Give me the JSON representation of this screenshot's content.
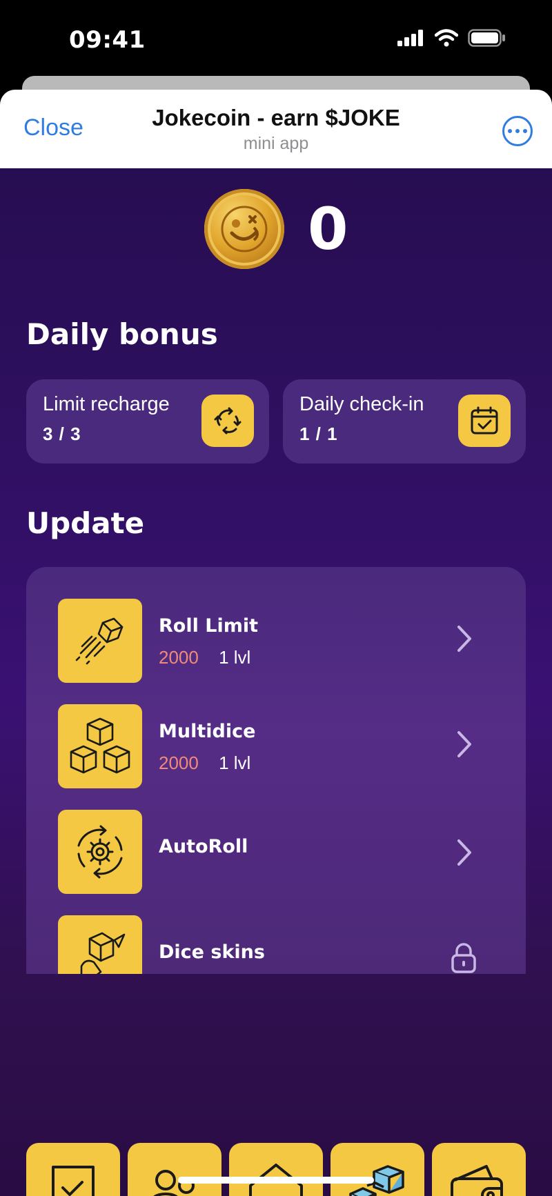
{
  "status_bar": {
    "time": "09:41",
    "icons": [
      "signal-icon",
      "wifi-icon",
      "battery-icon"
    ]
  },
  "header": {
    "close_label": "Close",
    "title": "Jokecoin - earn $JOKE",
    "subtitle": "mini app",
    "more_icon": "more-icon"
  },
  "balance": {
    "value": "0",
    "icon": "coin-icon"
  },
  "daily_bonus": {
    "title": "Daily bonus",
    "cards": [
      {
        "label": "Limit recharge",
        "count": "3 / 3",
        "icon": "recharge-icon"
      },
      {
        "label": "Daily check-in",
        "count": "1 / 1",
        "icon": "calendar-check-icon"
      }
    ]
  },
  "update": {
    "title": "Update",
    "items": [
      {
        "name": "Roll Limit",
        "price": "2000",
        "level": "1 lvl",
        "icon": "flying-cube-icon",
        "action": "chevron"
      },
      {
        "name": "Multidice",
        "price": "2000",
        "level": "1 lvl",
        "icon": "cubes-icon",
        "action": "chevron"
      },
      {
        "name": "AutoRoll",
        "icon": "gear-cycle-icon",
        "action": "chevron"
      },
      {
        "name": "Dice skins",
        "icon": "dice-skins-icon",
        "action": "lock"
      }
    ]
  },
  "nav": [
    "tasks-icon",
    "friends-icon",
    "home-icon",
    "cubes-icon",
    "wallet-icon"
  ],
  "colors": {
    "accent": "#f4c843",
    "link": "#2f7de1",
    "price": "#f08a7a",
    "card": "#4a2a7d"
  }
}
